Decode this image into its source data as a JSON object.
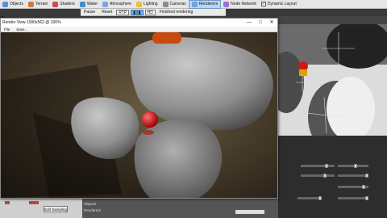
{
  "toolbar": {
    "items": [
      {
        "label": "Objects",
        "icon": "objects-icon",
        "color": "#5a8fd8"
      },
      {
        "label": "Terrain",
        "icon": "terrain-icon",
        "color": "#d07a3a"
      },
      {
        "label": "Shaders",
        "icon": "shaders-icon",
        "color": "#c94e4e"
      },
      {
        "label": "Water",
        "icon": "water-icon",
        "color": "#3d8fd0"
      },
      {
        "label": "Atmosphere",
        "icon": "atmosphere-icon",
        "color": "#7aa7e0"
      },
      {
        "label": "Lighting",
        "icon": "lighting-icon",
        "color": "#e6c23a"
      },
      {
        "label": "Cameras",
        "icon": "cameras-icon",
        "color": "#8a8a8a"
      },
      {
        "label": "Renderers",
        "icon": "renderers-icon",
        "color": "#6fa3d8"
      },
      {
        "label": "Node Network",
        "icon": "node-network-icon",
        "color": "#9a6fcf"
      }
    ],
    "active": "Renderers",
    "dynamic_layout_label": "Dynamic Layout",
    "dynamic_layout_checked": true
  },
  "toolbar2": {
    "pause": "Pause",
    "reset": "Reset",
    "rtp": "RTP",
    "hd": "HD",
    "status": "Finished rendering"
  },
  "render_window": {
    "title": "Render View 1000x562 @ 100%",
    "menus": [
      "File",
      "Save..."
    ],
    "controls": {
      "minimize": "—",
      "maximize": "□",
      "close": "✕"
    }
  },
  "bottom_panel": {
    "edit_sampling": "Edit Sampling",
    "tab_objects": "Objects",
    "tab_renderers": "Renderers"
  },
  "colors": {
    "selected_tab": "#bcd4ee",
    "scene_ground": "#4a3f2e",
    "sphere": "#e01818"
  }
}
